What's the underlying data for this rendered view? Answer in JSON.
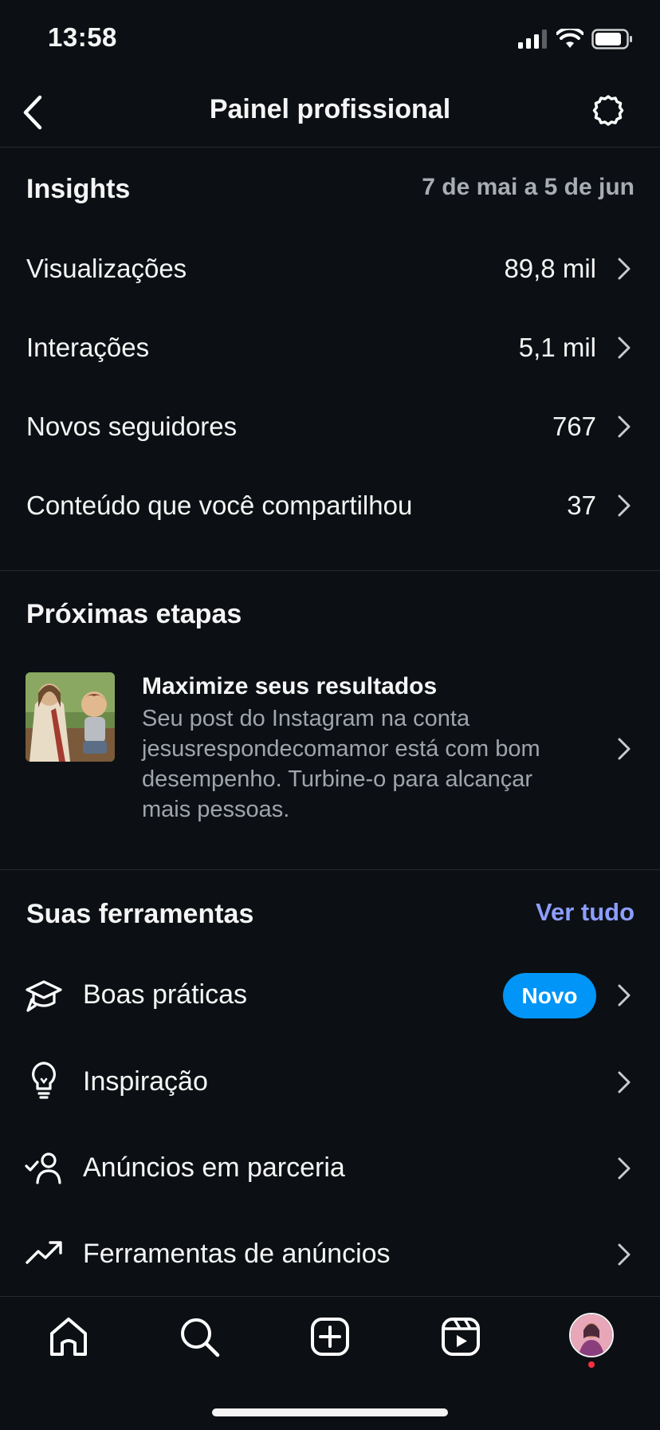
{
  "status_bar": {
    "time": "13:58"
  },
  "header": {
    "title": "Painel profissional"
  },
  "insights": {
    "title": "Insights",
    "date_range": "7 de mai a 5 de jun",
    "rows": [
      {
        "label": "Visualizações",
        "value": "89,8 mil"
      },
      {
        "label": "Interações",
        "value": "5,1 mil"
      },
      {
        "label": "Novos seguidores",
        "value": "767"
      },
      {
        "label": "Conteúdo que você compartilhou",
        "value": "37"
      }
    ]
  },
  "next_steps": {
    "title": "Próximas etapas",
    "card_title": "Maximize seus resultados",
    "card_body": "Seu post do Instagram na conta jesusrespondecomamor está com bom desempenho. Turbine-o para alcançar mais pessoas."
  },
  "tools": {
    "title": "Suas ferramentas",
    "see_all": "Ver tudo",
    "items": [
      {
        "label": "Boas práticas",
        "icon": "graduation-cap-icon",
        "badge": "Novo"
      },
      {
        "label": "Inspiração",
        "icon": "lightbulb-icon"
      },
      {
        "label": "Anúncios em parceria",
        "icon": "person-check-icon"
      },
      {
        "label": "Ferramentas de anúncios",
        "icon": "trending-up-icon"
      }
    ]
  },
  "tabbar": {
    "items": [
      "home-icon",
      "search-icon",
      "create-icon",
      "reels-icon",
      "profile-avatar"
    ]
  },
  "colors": {
    "background": "#0c1014",
    "accent_link": "#8c9eff",
    "badge": "#0095f6",
    "secondary_text": "#a8acb3"
  }
}
